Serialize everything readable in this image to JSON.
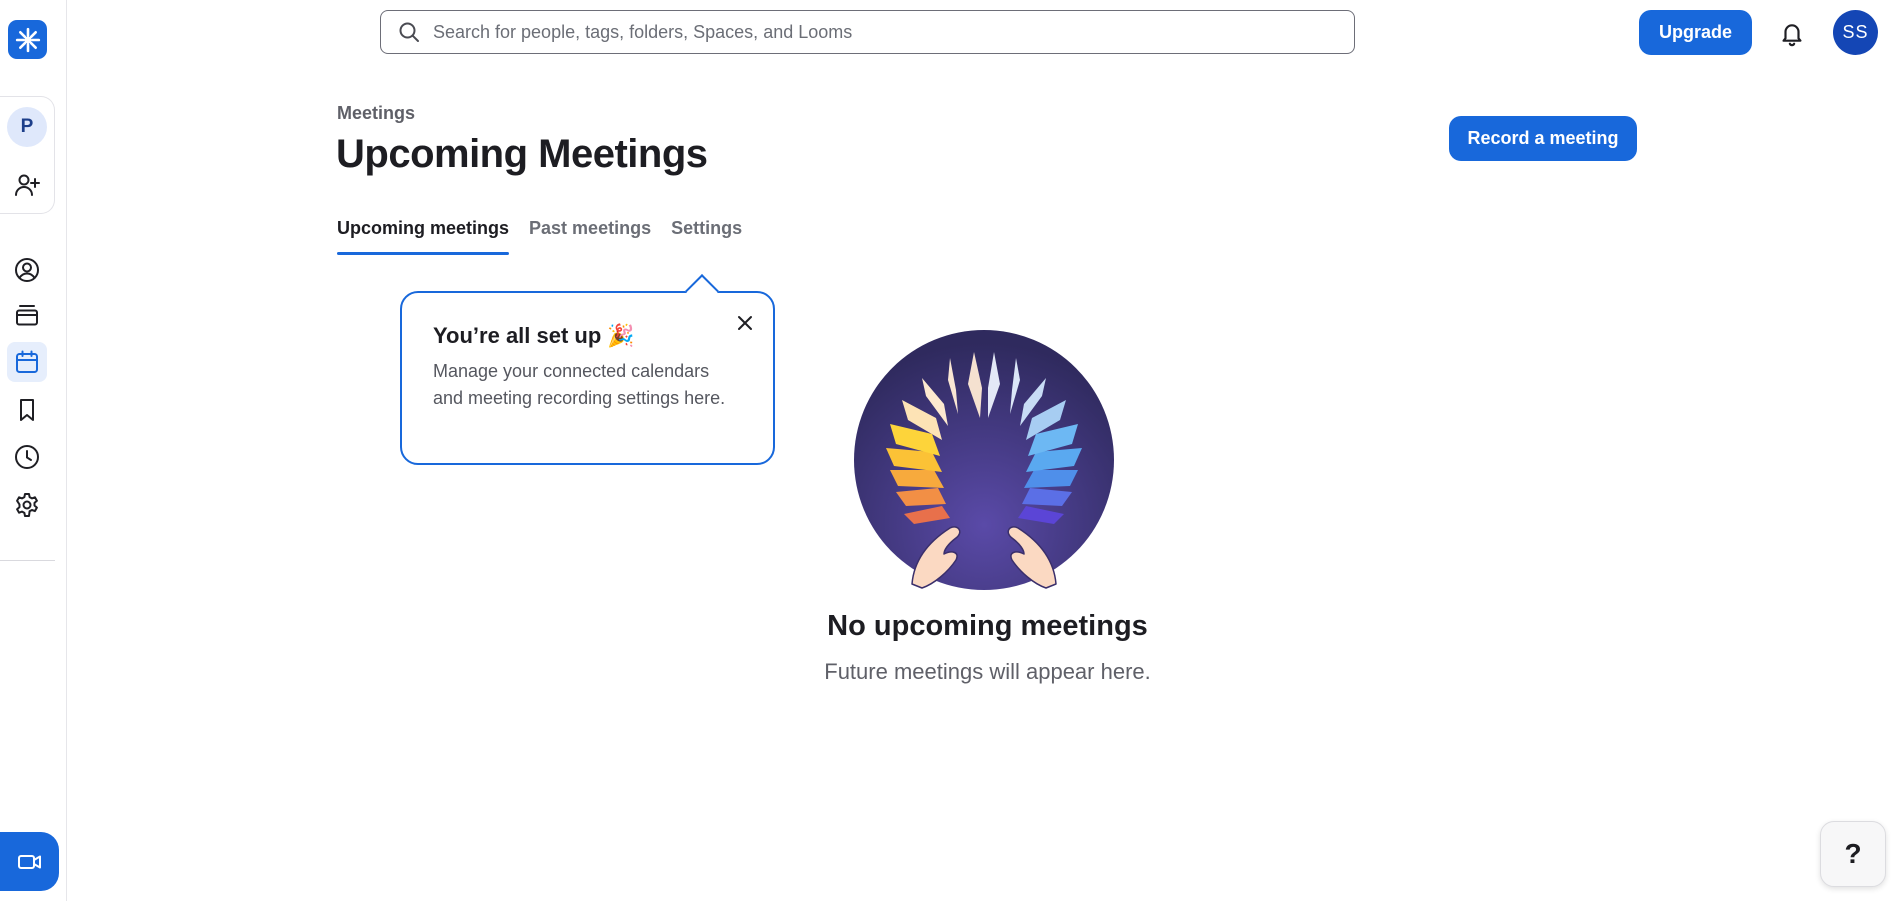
{
  "sidebar": {
    "logo_icon": "loom-asterisk-icon",
    "workspace_initial": "P",
    "items": [
      {
        "name": "invite-people",
        "icon": "add-user-icon"
      },
      {
        "name": "personal-library",
        "icon": "user-circle-icon"
      },
      {
        "name": "archive",
        "icon": "archive-box-icon"
      },
      {
        "name": "meetings",
        "icon": "calendar-icon",
        "active": true
      },
      {
        "name": "watch-later",
        "icon": "bookmark-icon"
      },
      {
        "name": "history",
        "icon": "clock-icon"
      },
      {
        "name": "settings",
        "icon": "gear-icon"
      }
    ],
    "record_icon": "video-camera-icon"
  },
  "topbar": {
    "search_placeholder": "Search for people, tags, folders, Spaces, and Looms",
    "upgrade_label": "Upgrade",
    "bell_icon": "bell-icon",
    "user_initials": "SS"
  },
  "header": {
    "breadcrumb": "Meetings",
    "title": "Upcoming Meetings",
    "record_button": "Record a meeting"
  },
  "tabs": [
    {
      "label": "Upcoming meetings",
      "active": true
    },
    {
      "label": "Past meetings",
      "active": false
    },
    {
      "label": "Settings",
      "active": false
    }
  ],
  "popover": {
    "title": "You’re all set up 🎉",
    "body": "Manage your connected calendars and meeting recording settings here."
  },
  "empty_state": {
    "title": "No upcoming meetings",
    "subtitle": "Future meetings will appear here."
  },
  "help": {
    "label": "?"
  },
  "colors": {
    "accent": "#1868db",
    "avatar": "#1446b5",
    "illustration_bg": "#3b3576"
  }
}
